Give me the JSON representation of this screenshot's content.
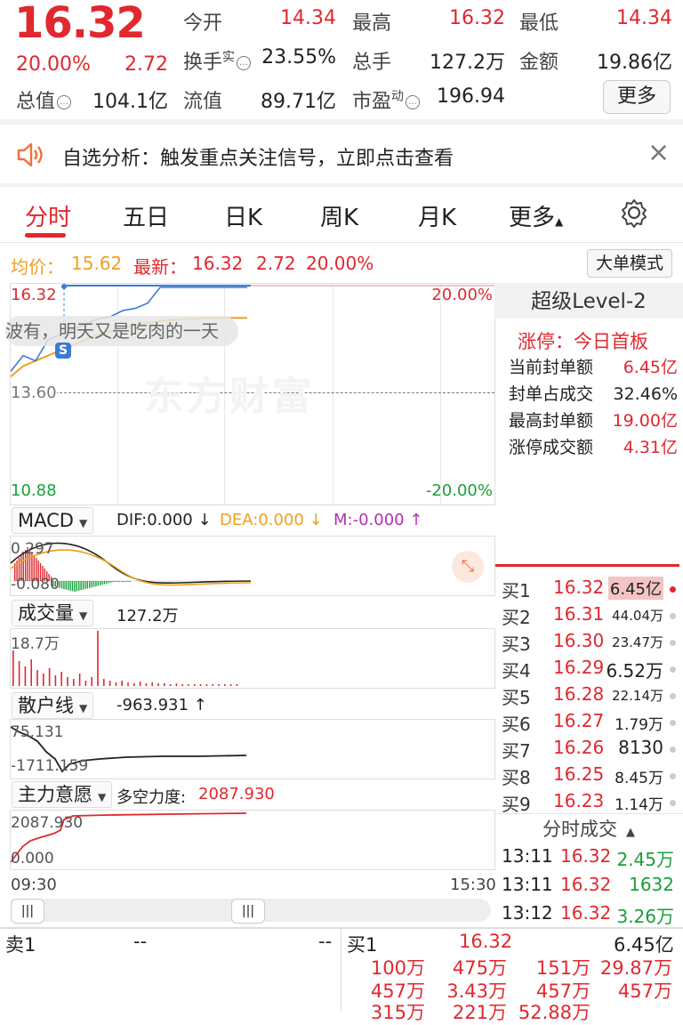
{
  "header": {
    "price": "16.32",
    "pct": "20.00%",
    "change": "2.72",
    "open_label": "今开",
    "open": "14.34",
    "high_label": "最高",
    "high": "16.32",
    "low_label": "最低",
    "low": "14.34",
    "turnover_label": "换手",
    "turnover_sup": "实",
    "turnover": "23.55%",
    "volume_label": "总手",
    "volume": "127.2万",
    "amount_label": "金额",
    "amount": "19.86亿",
    "mktcap_label": "总值",
    "mktcap": "104.1亿",
    "float_label": "流值",
    "float": "89.71亿",
    "pe_label": "市盈",
    "pe_sup": "动",
    "pe": "196.94",
    "more": "更多"
  },
  "banner": {
    "text": "自选分析：触发重点关注信号，立即点击查看",
    "close": "×"
  },
  "tabs": [
    "分时",
    "五日",
    "日K",
    "周K",
    "月K",
    "更多"
  ],
  "subheader": {
    "avg_label": "均价：",
    "avg": "15.62",
    "latest_label": "最新：",
    "latest": "16.32",
    "change": "2.72",
    "pct": "20.00%",
    "mode_button": "大单模式"
  },
  "price_chart": {
    "top_price": "16.32",
    "mid_price": "13.60",
    "bottom_price": "10.88",
    "top_pct": "20.00%",
    "bottom_pct": "-20.00%",
    "bullet": "波有，明天又是吃肉的一天",
    "bullet_badge": "S",
    "watermark": "东方财富",
    "price_path": [
      0.2,
      0.35,
      0.3,
      0.5,
      0.55,
      0.6,
      0.65,
      0.7,
      0.72,
      0.78,
      0.8,
      0.85,
      1,
      1,
      1,
      1,
      1,
      1,
      1,
      1
    ],
    "avg_path": [
      0.15,
      0.25,
      0.3,
      0.35,
      0.4,
      0.45,
      0.5,
      0.55,
      0.58,
      0.62,
      0.64,
      0.66,
      0.68,
      0.69,
      0.7,
      0.7,
      0.71,
      0.71,
      0.71,
      0.71
    ]
  },
  "macd": {
    "selector": "MACD",
    "dif": "DIF:0.000 ↓",
    "dea": "DEA:0.000 ↓",
    "m": "M:-0.000 ↑",
    "top_val": "0.297",
    "bottom_val": "-0.080"
  },
  "volume": {
    "selector": "成交量",
    "value": "127.2万",
    "max": "18.7万"
  },
  "retail": {
    "selector": "散户线",
    "value": "-963.931 ↑",
    "top": "75.131",
    "bottom": "-1711.159"
  },
  "main_force": {
    "selector": "主力意愿",
    "label": "多空力度:",
    "value": "2087.930",
    "top": "2087.930",
    "bottom": "0.000"
  },
  "time_axis": {
    "start": "09:30",
    "end": "15:30"
  },
  "level2": {
    "title": "超级Level-2",
    "limit_title": "涨停：今日首板",
    "rows": [
      {
        "label": "当前封单额",
        "value": "6.45亿"
      },
      {
        "label": "封单占成交",
        "value": "32.46%"
      },
      {
        "label": "最高封单额",
        "value": "19.00亿"
      },
      {
        "label": "涨停成交额",
        "value": "4.31亿"
      }
    ]
  },
  "orderbook": [
    {
      "label": "买1",
      "price": "16.32",
      "vol": "6.45亿",
      "hl": true
    },
    {
      "label": "买2",
      "price": "16.31",
      "vol": "44.04万"
    },
    {
      "label": "买3",
      "price": "16.30",
      "vol": "23.47万"
    },
    {
      "label": "买4",
      "price": "16.29",
      "vol": "6.52万"
    },
    {
      "label": "买5",
      "price": "16.28",
      "vol": "22.14万"
    },
    {
      "label": "买6",
      "price": "16.27",
      "vol": "1.79万"
    },
    {
      "label": "买7",
      "price": "16.26",
      "vol": "8130"
    },
    {
      "label": "买8",
      "price": "16.25",
      "vol": "8.45万"
    },
    {
      "label": "买9",
      "price": "16.23",
      "vol": "1.14万"
    }
  ],
  "trades": {
    "title": "分时成交",
    "rows": [
      {
        "time": "13:11",
        "price": "16.32",
        "vol": "2.45万"
      },
      {
        "time": "13:11",
        "price": "16.32",
        "vol": "1632"
      },
      {
        "time": "13:12",
        "price": "16.32",
        "vol": "3.26万"
      }
    ]
  },
  "bottom": {
    "sell_label": "卖1",
    "sell_price": "--",
    "sell_vol": "--",
    "buy_label": "买1",
    "buy_price": "16.32",
    "buy_vol": "6.45亿",
    "queue": [
      [
        "100万",
        "475万",
        "151万",
        "29.87万"
      ],
      [
        "457万",
        "3.43万",
        "457万",
        "457万"
      ],
      [
        "315万",
        "221万",
        "52.88万",
        ""
      ]
    ]
  },
  "colors": {
    "up": "#e0282e",
    "down": "#1a9e3a",
    "avg_line": "#f0a020",
    "price_line": "#3a7bd5"
  }
}
